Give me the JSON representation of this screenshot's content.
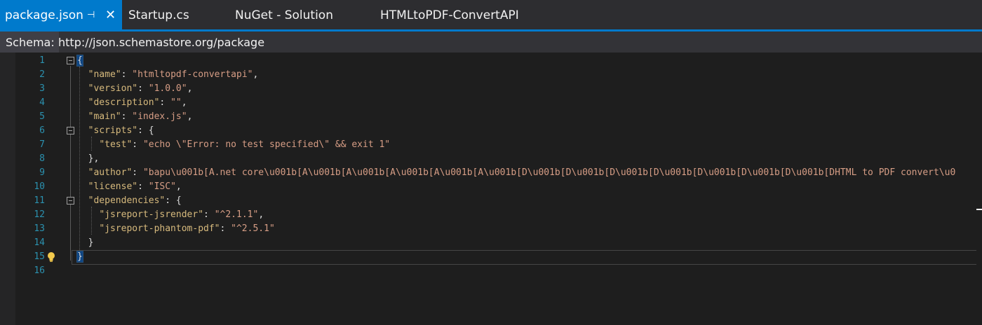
{
  "tabs": [
    {
      "label": "package.json",
      "active": true
    },
    {
      "label": "Startup.cs",
      "active": false
    },
    {
      "label": "NuGet - Solution",
      "active": false
    },
    {
      "label": "HTMLtoPDF-ConvertAPI",
      "active": false
    }
  ],
  "icons": {
    "pin": "pin-icon",
    "close": "close-icon",
    "lightbulb": "lightbulb-icon",
    "fold": "collapse-icon"
  },
  "schema": {
    "label": "Schema:",
    "value": "http://json.schemastore.org/package"
  },
  "colors": {
    "accent": "#007acc",
    "key": "#d7ba7d",
    "string": "#d69d85",
    "line_number": "#2b91af"
  },
  "lines": [
    {
      "n": "1"
    },
    {
      "n": "2"
    },
    {
      "n": "3"
    },
    {
      "n": "4"
    },
    {
      "n": "5"
    },
    {
      "n": "6"
    },
    {
      "n": "7"
    },
    {
      "n": "8"
    },
    {
      "n": "9"
    },
    {
      "n": "10"
    },
    {
      "n": "11"
    },
    {
      "n": "12"
    },
    {
      "n": "13"
    },
    {
      "n": "14"
    },
    {
      "n": "15"
    },
    {
      "n": "16"
    }
  ],
  "json": {
    "open": "{",
    "close": "}",
    "name_key": "\"name\"",
    "name_val": "\"htmltopdf-convertapi\"",
    "version_key": "\"version\"",
    "version_val": "\"1.0.0\"",
    "description_key": "\"description\"",
    "description_val": "\"\"",
    "main_key": "\"main\"",
    "main_val": "\"index.js\"",
    "scripts_key": "\"scripts\"",
    "test_key": "\"test\"",
    "test_val": "\"echo \\\"Error: no test specified\\\" && exit 1\"",
    "author_key": "\"author\"",
    "author_val": "\"bapu\\u001b[A.net core\\u001b[A\\u001b[A\\u001b[A\\u001b[A\\u001b[A\\u001b[D\\u001b[D\\u001b[D\\u001b[D\\u001b[D\\u001b[D\\u001b[D\\u001b[DHTML to PDF convert\\u0",
    "license_key": "\"license\"",
    "license_val": "\"ISC\"",
    "dependencies_key": "\"dependencies\"",
    "dep1_key": "\"jsreport-jsrender\"",
    "dep1_val": "\"^2.1.1\"",
    "dep2_key": "\"jsreport-phantom-pdf\"",
    "dep2_val": "\"^2.5.1\""
  }
}
